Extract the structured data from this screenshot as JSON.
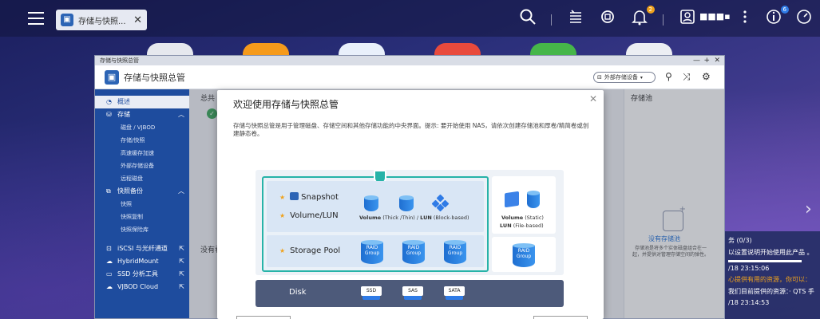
{
  "desktop": {
    "taskbar_tab_label": "存储与快照...",
    "user_name": "■■■▪",
    "notification_badge": "2",
    "info_badge": "6"
  },
  "notifications": {
    "item1_title": "务 (0/3)",
    "item1_text": "以设置说明开始使用此产品 。",
    "item1_time": "/18 23:15:06",
    "item2_text": "心提供有用的资源，你可以：",
    "item2_sub": "我们目前提供的资源：· QTS 手",
    "item2_time": "/18 23:14:53"
  },
  "window": {
    "title": "存储与快照总管",
    "header_title": "存储与快照总管",
    "ext_button_label": "外部存储设备"
  },
  "sidebar": {
    "items": [
      {
        "label": "概述"
      },
      {
        "label": "存储"
      },
      {
        "label": "磁盘 / VJBOD"
      },
      {
        "label": "存储/快照"
      },
      {
        "label": "高速缓存加速"
      },
      {
        "label": "外部存储设备"
      },
      {
        "label": "远程磁盘"
      },
      {
        "label": "快照备份"
      },
      {
        "label": "快照"
      },
      {
        "label": "快照复制"
      },
      {
        "label": "快照保险库"
      },
      {
        "label": "iSCSI 与光纤通道"
      },
      {
        "label": "HybridMount"
      },
      {
        "label": "SSD 分析工具"
      },
      {
        "label": "VJBOD Cloud"
      }
    ]
  },
  "content": {
    "left_header": "总共",
    "no_items": "没有看",
    "pool_panel_title": "存储池",
    "pool_link": "没有存储池",
    "pool_desc": "存储池是将多个实体磁盘组合在一起，并提供对管理存储空间的弹性。"
  },
  "modal": {
    "title": "欢迎使用存储与快照总管",
    "description": "存储与快照总管是用于管理磁盘、存储空间和其他存储功能的中央界面。提示: 要开始使用 NAS，请依次创建存储池和厚卷/精简卷或创建静态卷。",
    "diagram": {
      "snapshot_label": "Snapshot",
      "volume_lun_label": "Volume/LUN",
      "storage_pool_label": "Storage Pool",
      "disk_label": "Disk",
      "volume_bold": "Volume",
      "volume_sub": "(Thick /Thin)",
      "lun_bold": "LUN",
      "lun_sub": "(Block-based)",
      "volume_static_bold": "Volume",
      "volume_static_sub": "(Static)",
      "lun_file_bold": "LUN",
      "lun_file_sub": "(File-based)",
      "raid_label": "RAID Group",
      "drives": [
        "SSD",
        "SAS",
        "SATA"
      ]
    }
  },
  "colors": {
    "sidebar_bg": "#1e4c9e",
    "accent_teal": "#27b3a8",
    "accent_blue": "#2f7be6",
    "star": "#f0a21c",
    "disk_bar": "#4d5a7a"
  }
}
